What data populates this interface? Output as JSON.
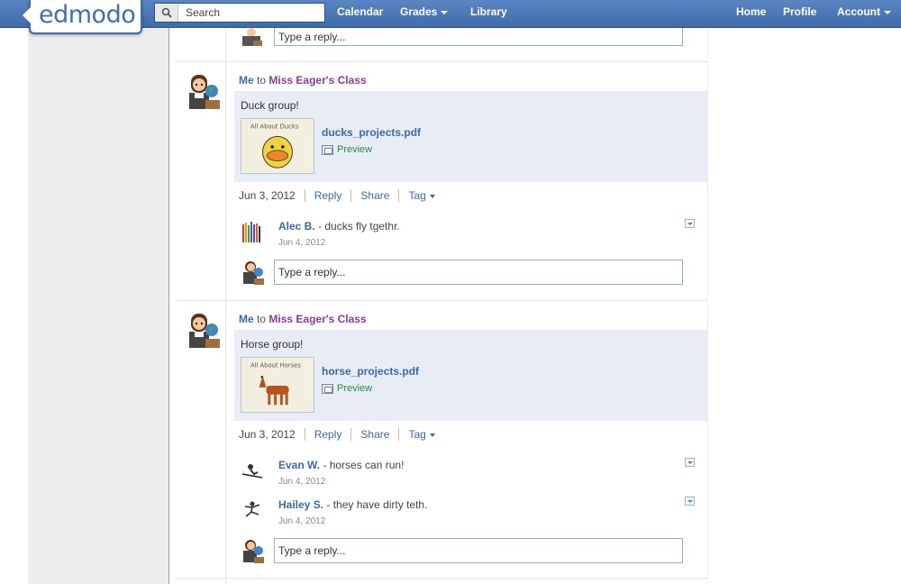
{
  "brand": {
    "logo_text": "edmodo"
  },
  "search": {
    "placeholder": "Search"
  },
  "nav": {
    "calendar": "Calendar",
    "grades": "Grades",
    "library": "Library",
    "home": "Home",
    "profile": "Profile",
    "account": "Account"
  },
  "reply_placeholder": "Type a reply...",
  "posts": [
    {
      "sender": "Me",
      "to_word": "to",
      "recipient": "Miss Eager's Class",
      "message": "Duck group!",
      "attachment": {
        "file": "ducks_projects.pdf",
        "preview": "Preview",
        "thumb_label": "All About Ducks"
      },
      "date": "Jun 3, 2012",
      "actions": {
        "reply": "Reply",
        "share": "Share",
        "tag": "Tag"
      },
      "comments": [
        {
          "name": "Alec B.",
          "text": "- ducks fly tgethr.",
          "date": "Jun 4, 2012"
        }
      ]
    },
    {
      "sender": "Me",
      "to_word": "to",
      "recipient": "Miss Eager's Class",
      "message": "Horse group!",
      "attachment": {
        "file": "horse_projects.pdf",
        "preview": "Preview",
        "thumb_label": "All About Horses"
      },
      "date": "Jun 3, 2012",
      "actions": {
        "reply": "Reply",
        "share": "Share",
        "tag": "Tag"
      },
      "comments": [
        {
          "name": "Evan W.",
          "text": "- horses can run!",
          "date": "Jun 4, 2012"
        },
        {
          "name": "Hailey S.",
          "text": "- they have dirty teth.",
          "date": "Jun 4, 2012"
        }
      ]
    }
  ]
}
